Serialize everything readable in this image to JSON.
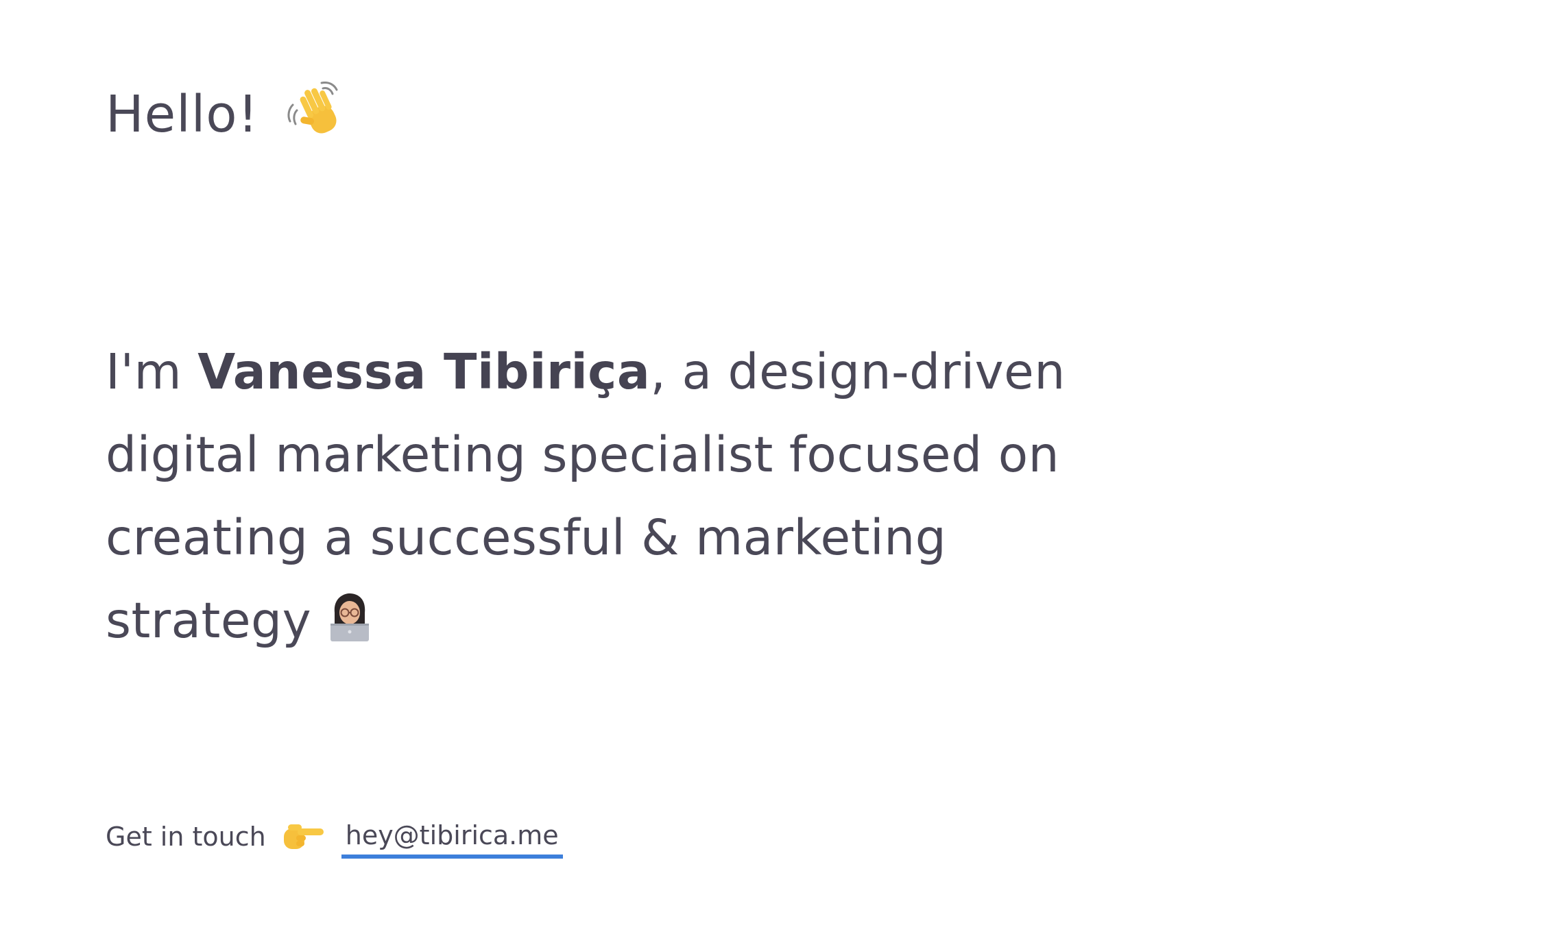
{
  "greeting": {
    "text": "Hello!",
    "emoji": "waving-hand-icon"
  },
  "intro": {
    "prefix": "I'm ",
    "name": "Vanessa Tibiriça",
    "line1_suffix": ", a design-driven",
    "line2": "digital marketing specialist focused on",
    "line3": "creating a successful & marketing",
    "line4": "strategy",
    "emoji": "woman-technologist-icon"
  },
  "contact": {
    "label": "Get in touch",
    "emoji": "pointing-right-icon",
    "email": "hey@tibirica.me",
    "link_underline_color": "#3d7fdb"
  },
  "colors": {
    "text": "#4a4857",
    "background": "#ffffff",
    "accent": "#3d7fdb"
  }
}
